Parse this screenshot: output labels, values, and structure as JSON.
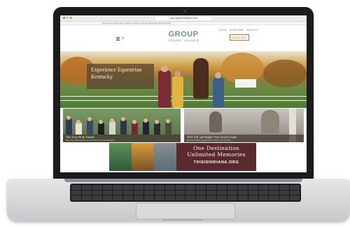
{
  "browser": {
    "url": "r.grouptraveleader.com",
    "bookmarks": "Home   The Globe   Daily Outdoor   Google   YouTube   Wikipedia   News   Popular"
  },
  "header": {
    "logo_top": "GROUP",
    "logo_bottom": "TRAVEL LEADER",
    "links": [
      "LOG IN",
      "SUBSCRIBE",
      "MEDIA KIT"
    ],
    "subscribe_label": "SUBSCRIBE"
  },
  "hero": {
    "title": "Experience Equestrian Kentucky"
  },
  "cards": [
    {
      "title": "The Tour Work Family",
      "subtitle": "Meet the staff behind your favorite travel destinations"
    },
    {
      "title": "2021 UK and Rights Tour Travel Guide",
      "subtitle": "Explore historic destinations across the country"
    }
  ],
  "ad": {
    "line1": "One Destination",
    "line2": "Unlimited Memories",
    "url": "THISISINDIANA.ORG"
  },
  "colors": {
    "brand": "#6f8f9a",
    "accent": "#b8762d",
    "ad_bg": "#5b2a2e"
  }
}
